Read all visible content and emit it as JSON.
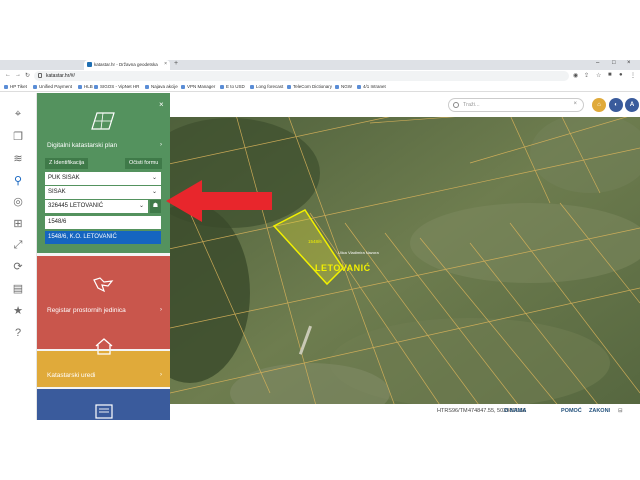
{
  "browser": {
    "tab_title": "katastar.hr - Državna geodetska",
    "tab_close": "×",
    "new_tab": "+",
    "address": "katastar.hr/#/",
    "bookmarks": [
      "HP Tiket",
      "Unified Payment",
      "HLB",
      "SIGOS - VipNet HR",
      "Najava akcije",
      "VPN Manager",
      "E to USD",
      "Long forecast",
      "TeleCom Dictionary",
      "NGW",
      "4/1 Intranet"
    ]
  },
  "app": {
    "search_placeholder": "Traži...",
    "search_clear": "×",
    "side_panel": {
      "close": "×",
      "card1_title": "Digitalni katastarski plan",
      "chevron": "›",
      "btn_identifikacija": "Z Identifikacija",
      "btn_ocisti": "Očisti formu",
      "field_puk": "PUK SISAK",
      "field_ured": "SISAK",
      "field_ko": "326445 LETOVANIĆ",
      "field_cestica": "1548/6",
      "suggestion": "1548/6, K.O. LETOVANIĆ",
      "card2_title": "Registar prostornih jedinica",
      "card3_title": "Katastarski uredi"
    },
    "status": {
      "projection": "HTRS96/TM",
      "coordinates": "474847.55, 5039891.56",
      "links": [
        "O NAMA",
        "POMOĆ",
        "ZAKONI"
      ]
    },
    "map": {
      "parcel_label": "1548/6",
      "town_label": "LETOVANIĆ",
      "road_label": "Ulica Vladimira Nazora"
    }
  },
  "colors": {
    "card1": "#54925e",
    "card2": "#c9564c",
    "card3": "#e0aa3a",
    "card4": "#3a5b9c",
    "arrow": "#e8262c",
    "parcel": "#f2f000"
  }
}
